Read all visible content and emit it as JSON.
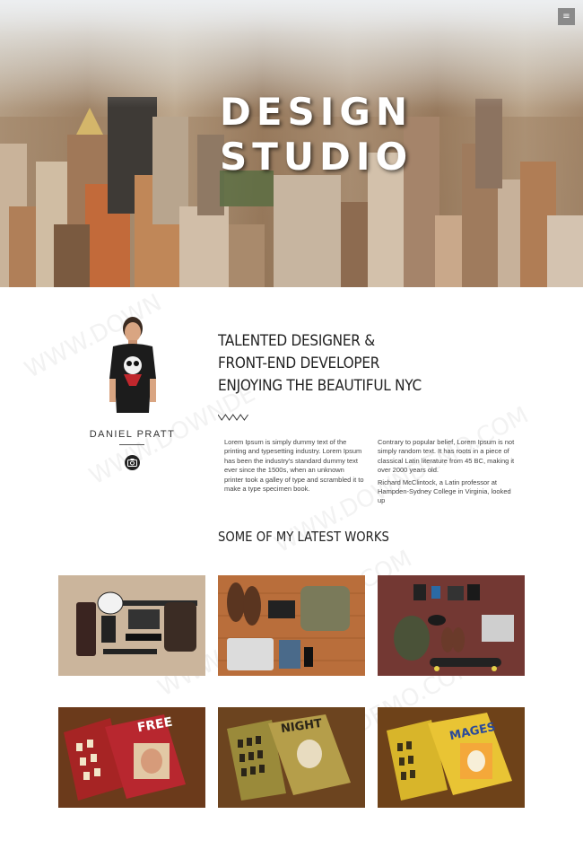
{
  "hero": {
    "title_line1": "DESIGN",
    "title_line2": "STUDIO",
    "menu_icon": "≡"
  },
  "profile": {
    "name": "DANIEL PRATT",
    "social_icon": "camera-icon"
  },
  "about": {
    "headline": [
      "TALENTED DESIGNER &",
      "FRONT-END DEVELOPER",
      "ENJOYING THE BEAUTIFUL NYC"
    ],
    "col1": "Lorem Ipsum is simply dummy text of the printing and typesetting industry. Lorem Ipsum has been the industry's standard dummy text ever since the 1500s, when an unknown printer took a galley of type and scrambled it to make a type specimen book.",
    "col2_p1": "Contrary to popular belief, Lorem Ipsum is not simply random text. It has roots in a piece of classical Latin literature from 45 BC, making it over 2000 years old.",
    "col2_p2": "Richard McClintock, a Latin professor at Hampden-Sydney College in Virginia, looked up"
  },
  "works": {
    "title": "SOME OF MY LATEST WORKS",
    "items": [
      {
        "name": "flat-lay-guitar"
      },
      {
        "name": "flat-lay-laptop-bag"
      },
      {
        "name": "flat-lay-skateboard"
      },
      {
        "name": "book-cover-red",
        "cover_text": "FREE"
      },
      {
        "name": "book-cover-olive",
        "cover_text": "NIGHT"
      },
      {
        "name": "book-cover-yellow",
        "cover_text": "MAGES"
      }
    ]
  },
  "colors": {
    "accent": "#222222",
    "text": "#444444"
  }
}
